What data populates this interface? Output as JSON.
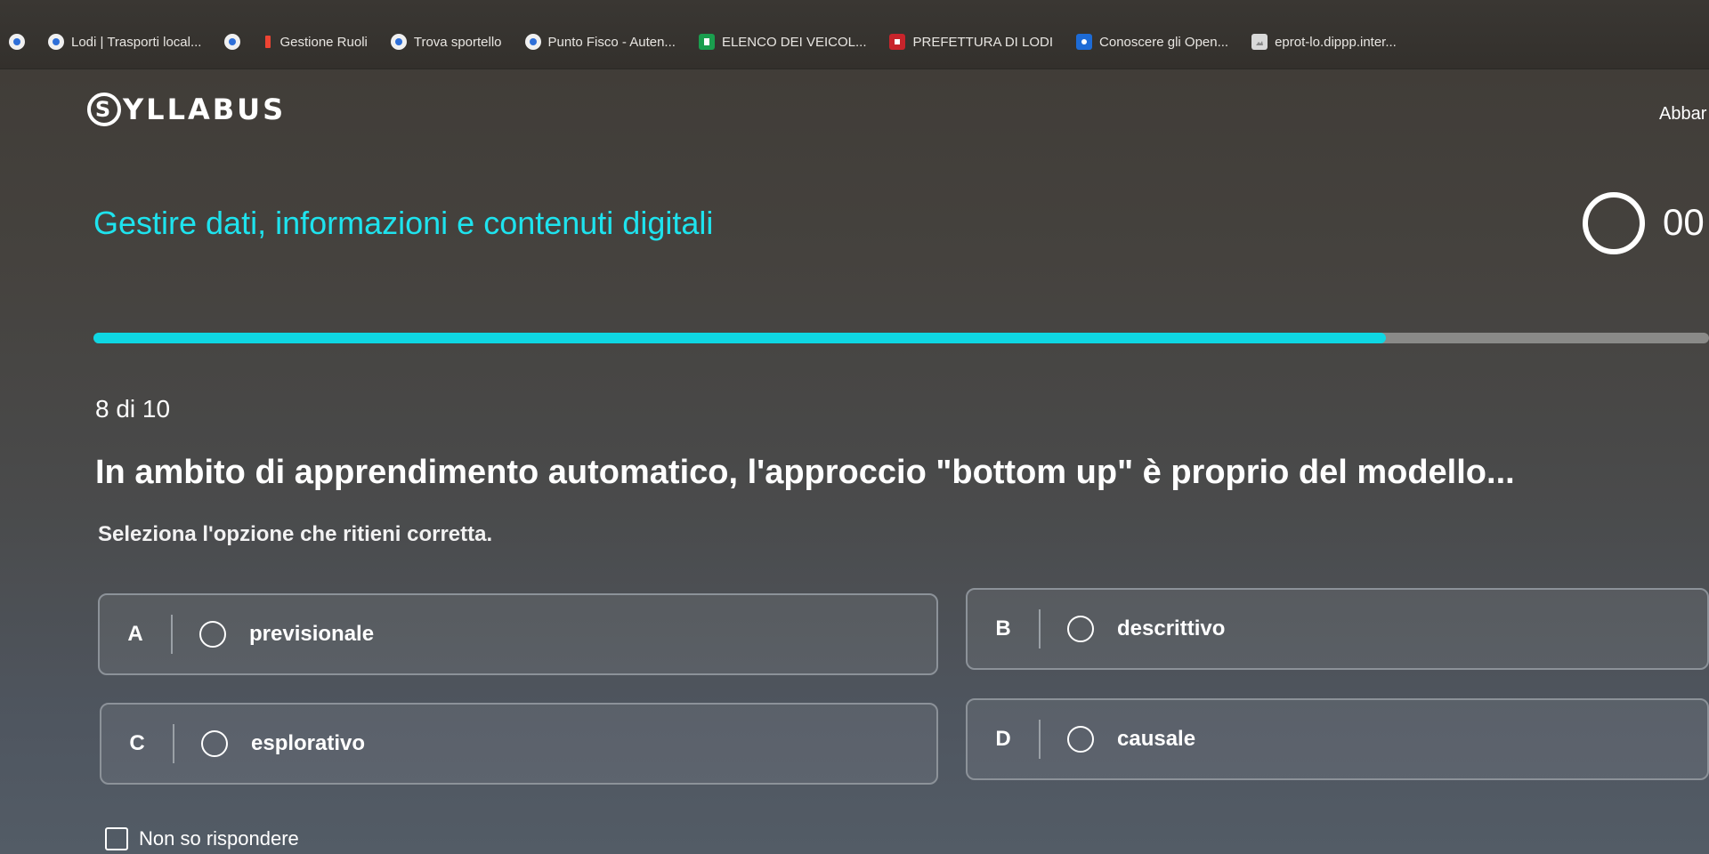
{
  "browser": {
    "bookmarks": [
      {
        "label": "",
        "icon": "globe-icon"
      },
      {
        "label": "Lodi | Trasporti local...",
        "icon": "globe-icon"
      },
      {
        "label": "",
        "icon": "globe-icon"
      },
      {
        "label": "Gestione Ruoli",
        "icon": "flag-icon"
      },
      {
        "label": "Trova sportello",
        "icon": "globe-icon"
      },
      {
        "label": "Punto Fisco - Auten...",
        "icon": "globe-icon"
      },
      {
        "label": "ELENCO DEI VEICOL...",
        "icon": "document-icon"
      },
      {
        "label": "PREFETTURA DI LODI",
        "icon": "seal-icon"
      },
      {
        "label": "Conoscere gli Open...",
        "icon": "app-icon"
      },
      {
        "label": "eprot-lo.dippp.inter...",
        "icon": "image-icon"
      }
    ]
  },
  "header": {
    "logo": "YLLABUS",
    "logo_letter": "S",
    "abbandona": "Abbar"
  },
  "module": {
    "title": "Gestire dati, informazioni e contenuti digitali",
    "timer": "00"
  },
  "progress": {
    "fraction": 0.8,
    "fill_color": "#0fd7e3"
  },
  "quiz": {
    "counter": "8 di 10",
    "question": "In ambito di apprendimento automatico, l'approccio \"bottom up\" è proprio del modello...",
    "instruction": "Seleziona l'opzione che ritieni corretta.",
    "options": [
      {
        "letter": "A",
        "label": "previsionale"
      },
      {
        "letter": "B",
        "label": "descrittivo"
      },
      {
        "letter": "C",
        "label": "esplorativo"
      },
      {
        "letter": "D",
        "label": "causale"
      }
    ],
    "dont_know": "Non so rispondere"
  }
}
